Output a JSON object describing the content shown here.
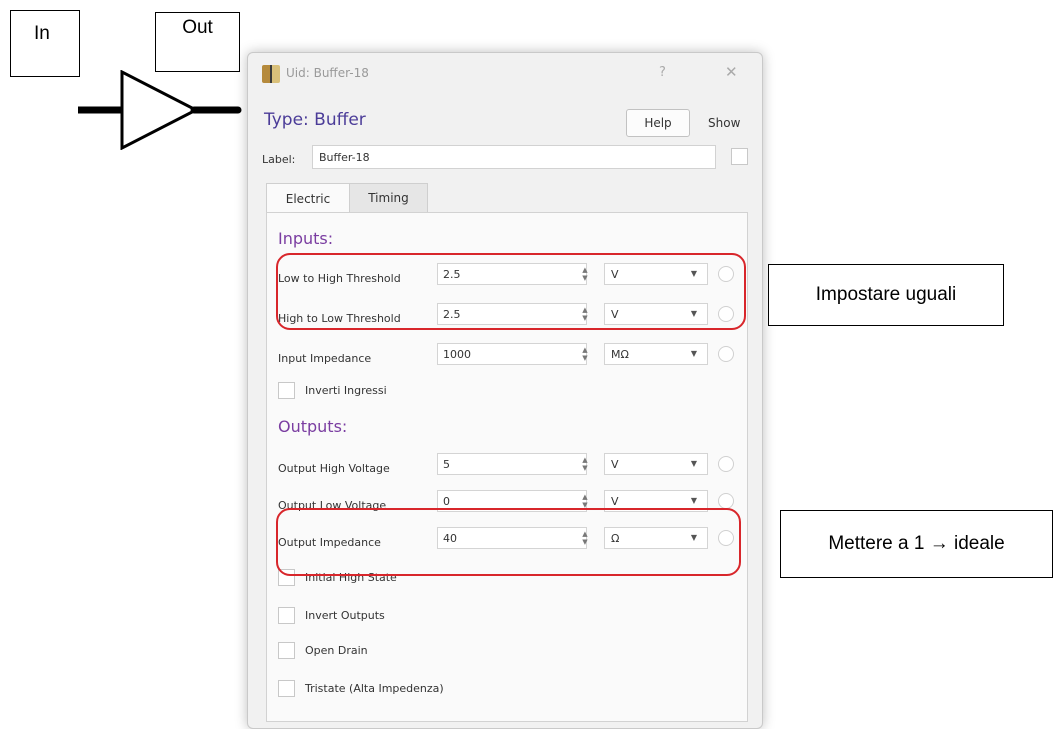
{
  "annotations": {
    "in": "In",
    "out": "Out",
    "equal_note": "Impostare uguali",
    "ideal_note": "Mettere a 1 → ideale",
    "highlight_color": "#d8262b"
  },
  "window": {
    "title": "Uid: Buffer-18",
    "help_glyph": "?",
    "close_glyph": "✕"
  },
  "header": {
    "type_label": "Type: Buffer",
    "help_button": "Help",
    "show_label": "Show"
  },
  "label_field": {
    "caption": "Label:",
    "value": "Buffer-18"
  },
  "tabs": [
    {
      "label": "Electric",
      "active": true
    },
    {
      "label": "Timing",
      "active": false
    }
  ],
  "inputs": {
    "title": "Inputs:",
    "rows": [
      {
        "label": "Low to High Threshold",
        "value": "2.5",
        "unit": "V"
      },
      {
        "label": "High to Low Threshold",
        "value": "2.5",
        "unit": "V"
      },
      {
        "label": "Input Impedance",
        "value": "1000",
        "unit": "MΩ"
      }
    ],
    "invert_inputs": "Inverti Ingressi"
  },
  "outputs": {
    "title": "Outputs:",
    "rows": [
      {
        "label": "Output High Voltage",
        "value": "5",
        "unit": "V"
      },
      {
        "label": "Output Low Voltage",
        "value": "0",
        "unit": "V"
      },
      {
        "label": "Output Impedance",
        "value": "40",
        "unit": "Ω"
      }
    ],
    "checks": [
      "Initial High State",
      "Invert Outputs",
      "Open Drain",
      "Tristate (Alta Impedenza)"
    ]
  },
  "colors": {
    "type_label": "#4b3c98",
    "section_title": "#7a3da1"
  }
}
